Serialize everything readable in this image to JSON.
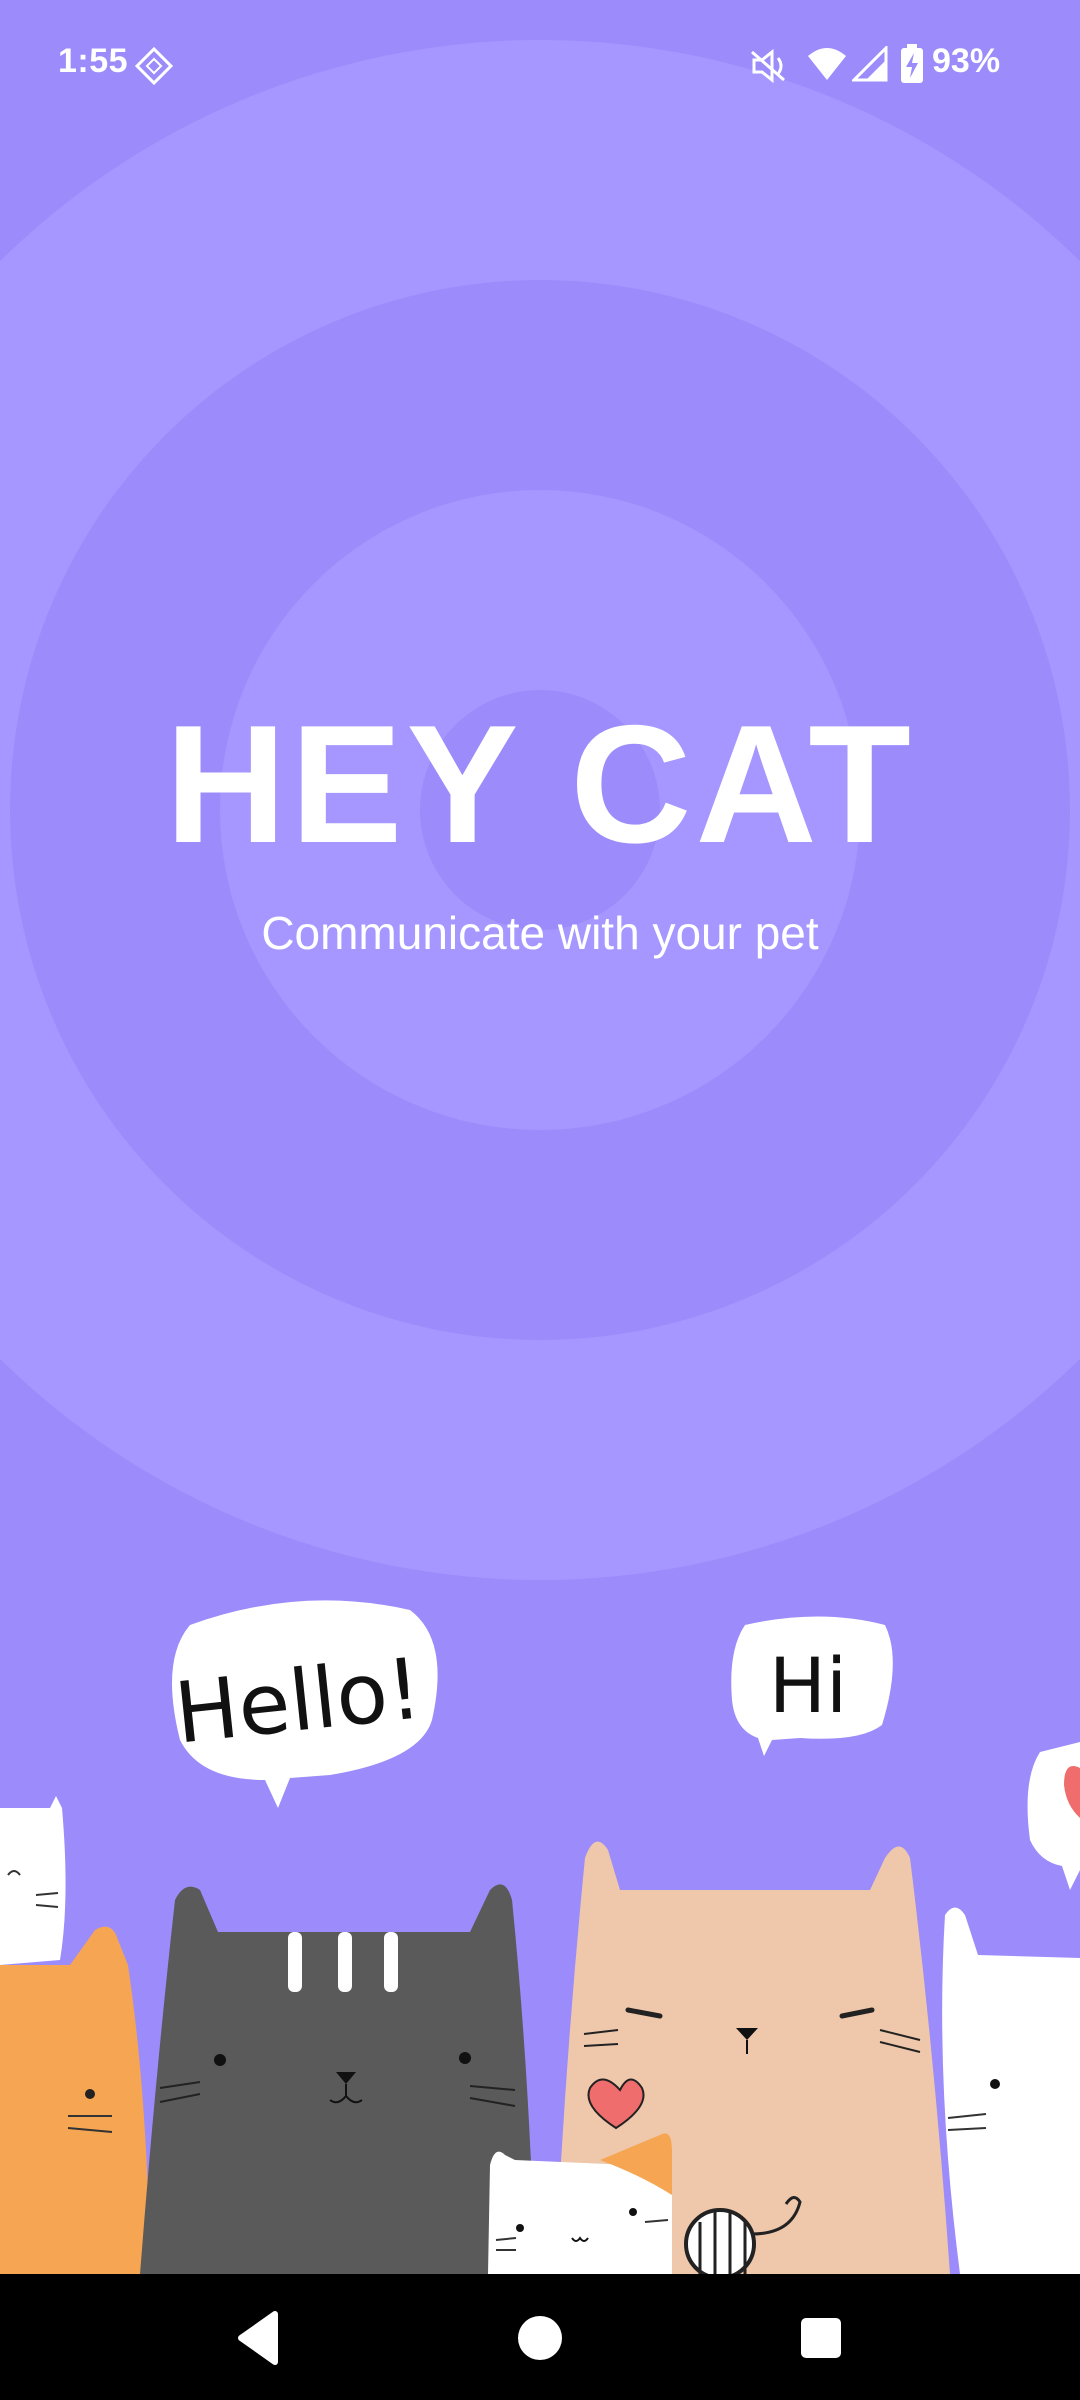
{
  "status_bar": {
    "time": "1:55",
    "battery_percent": "93%",
    "icons": [
      "tiktok-style-diamond-icon",
      "mute-icon",
      "wifi-icon",
      "signal-icon",
      "battery-charging-icon"
    ]
  },
  "app": {
    "title": "HEY CAT",
    "subtitle": "Communicate with your pet"
  },
  "illustration": {
    "bubble_hello": "Hello!",
    "bubble_hi": "Hi"
  },
  "nav_bar": {
    "icons": [
      "back-icon",
      "home-icon",
      "recents-icon"
    ]
  },
  "colors": {
    "background": "#9c8cfb",
    "ring_light": "#a597ff",
    "text": "#ffffff",
    "nav_background": "#000000"
  }
}
